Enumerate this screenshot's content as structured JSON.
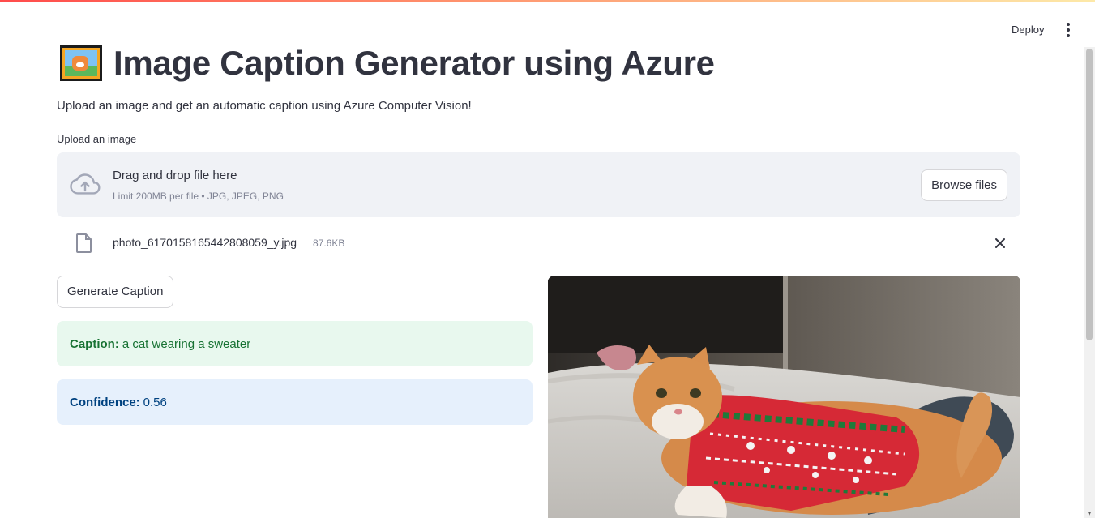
{
  "header": {
    "deploy_label": "Deploy",
    "menu_icon": "kebab-menu-icon"
  },
  "page": {
    "title": "Image Caption Generator using Azure",
    "title_icon": "framed-picture-icon",
    "subtitle": "Upload an image and get an automatic caption using Azure Computer Vision!"
  },
  "uploader": {
    "label": "Upload an image",
    "drop_text": "Drag and drop file here",
    "limit_text": "Limit 200MB per file • JPG, JPEG, PNG",
    "browse_label": "Browse files",
    "icon": "cloud-upload-icon"
  },
  "file": {
    "name": "photo_6170158165442808059_y.jpg",
    "size": "87.6KB",
    "icon": "file-icon",
    "remove_icon": "close-icon"
  },
  "actions": {
    "generate_label": "Generate Caption"
  },
  "result": {
    "caption_label": "Caption:",
    "caption_value": "a cat wearing a sweater",
    "confidence_label": "Confidence:",
    "confidence_value": "0.56"
  },
  "colors": {
    "accent": "#ff4b4b",
    "success_bg": "#e8f8ee",
    "success_text": "#177233",
    "info_bg": "#e6f0fc",
    "info_text": "#004280",
    "dropzone_bg": "#f0f2f6"
  }
}
